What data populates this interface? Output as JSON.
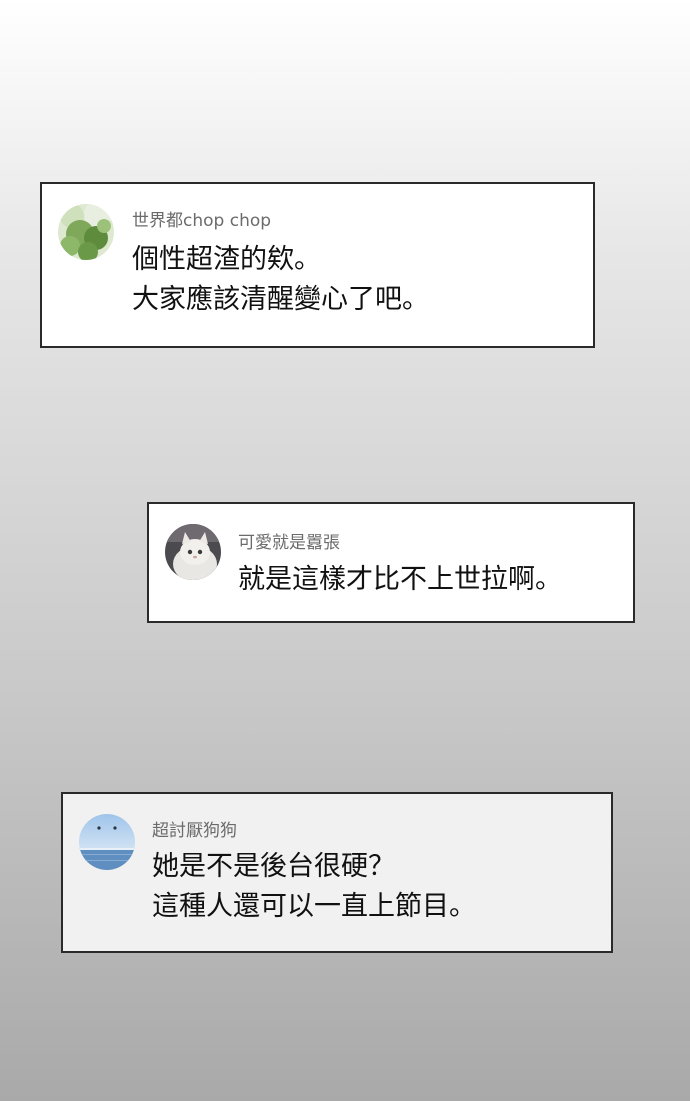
{
  "comments": [
    {
      "username": "世界都chop chop",
      "avatar": "green-leaves-avatar",
      "lines": [
        "個性超渣的欸。",
        "大家應該清醒變心了吧。"
      ]
    },
    {
      "username": "可愛就是囂張",
      "avatar": "white-cat-avatar",
      "lines": [
        "就是這樣才比不上世拉啊。"
      ]
    },
    {
      "username": "超討厭狗狗",
      "avatar": "sea-sky-avatar",
      "lines": [
        "她是不是後台很硬？",
        "這種人還可以一直上節目。"
      ]
    }
  ],
  "colors": {
    "card_border": "#2a2a2a",
    "username": "#6b6b6b",
    "comment_text": "#111111"
  }
}
